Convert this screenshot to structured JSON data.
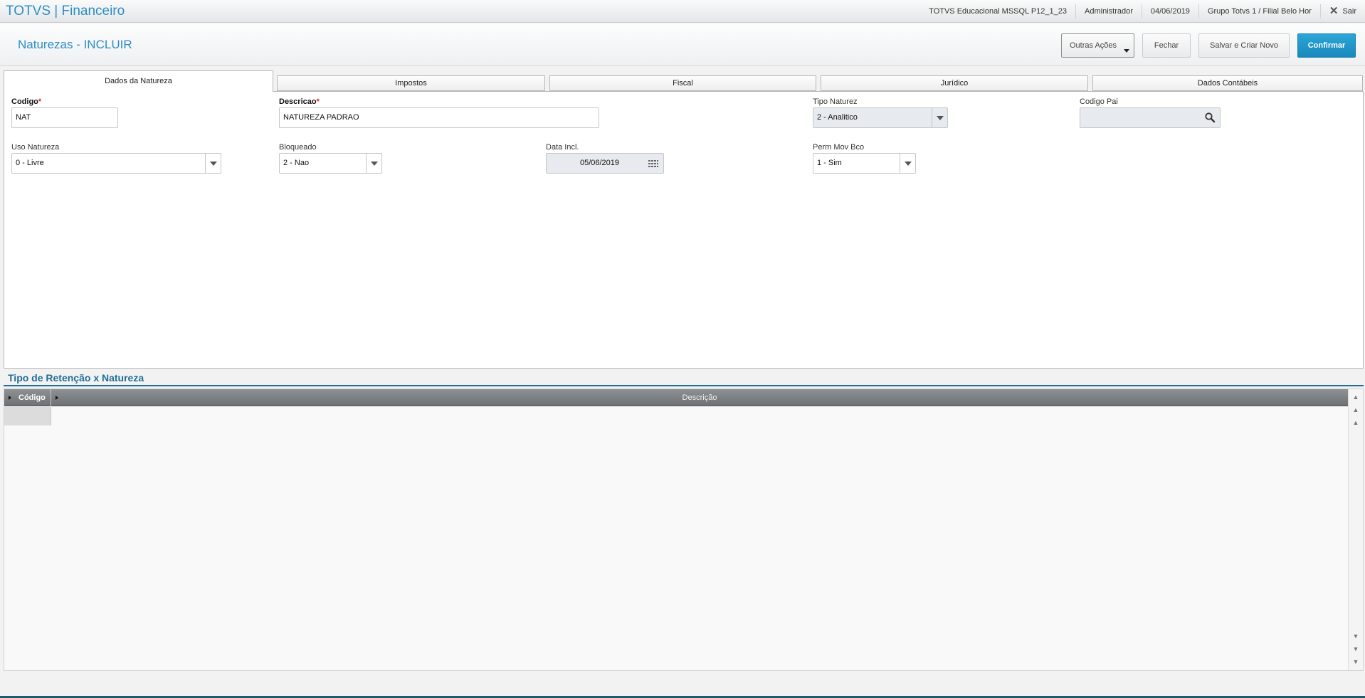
{
  "app": {
    "brand": "TOTVS | Financeiro"
  },
  "topbar": {
    "system": "TOTVS Educacional MSSQL P12_1_23",
    "user": "Administrador",
    "date": "04/06/2019",
    "branch": "Grupo Totvs 1 / Filial Belo Hor",
    "exit_label": "Sair"
  },
  "header": {
    "title": "Naturezas - INCLUIR",
    "buttons": {
      "outras": "Outras Ações",
      "fechar": "Fechar",
      "salvar": "Salvar e Criar Novo",
      "confirmar": "Confirmar"
    }
  },
  "tabs": [
    {
      "label": "Dados da Natureza",
      "active": true
    },
    {
      "label": "Impostos"
    },
    {
      "label": "Fiscal"
    },
    {
      "label": "Jurídico"
    },
    {
      "label": "Dados Contábeis"
    }
  ],
  "form": {
    "codigo": {
      "label": "Codigo",
      "required_mark": "*",
      "value": "NAT"
    },
    "descricao": {
      "label": "Descricao",
      "required_mark": "*",
      "value": "NATUREZA PADRAO"
    },
    "tipo_natureza": {
      "label": "Tipo Naturez",
      "value": "2 - Analitico"
    },
    "codigo_pai": {
      "label": "Codigo Pai",
      "value": ""
    },
    "uso_natureza": {
      "label": "Uso Natureza",
      "value": "0 - Livre"
    },
    "bloqueado": {
      "label": "Bloqueado",
      "value": "2 - Nao"
    },
    "data_incl": {
      "label": "Data Incl.",
      "value": "05/06/2019"
    },
    "perm_mov_bco": {
      "label": "Perm Mov Bco",
      "value": "1 - Sim"
    }
  },
  "section": {
    "title": "Tipo de Retenção x Natureza"
  },
  "grid": {
    "columns": [
      "Código",
      "Descrição"
    ],
    "rows": []
  },
  "colors": {
    "accent": "#2c8ec4",
    "confirm": "#1a88bd",
    "section": "#1f6e96"
  },
  "icons": [
    "close-icon",
    "search-icon",
    "calendar-icon",
    "chevron-down-icon",
    "scroll-up-icon",
    "scroll-down-icon"
  ]
}
